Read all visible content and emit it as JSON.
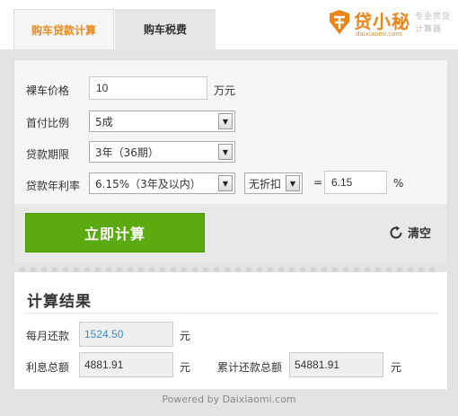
{
  "tabs": [
    {
      "label": "购车贷款计算",
      "active": true
    },
    {
      "label": "购车税费",
      "active": false
    }
  ],
  "logo": {
    "brand": "贷小秘",
    "domain": "daixiaomi.com",
    "slogan": "专业房贷计算器"
  },
  "form": {
    "price": {
      "label": "裸车价格",
      "value": "10",
      "unit": "万元"
    },
    "down_payment": {
      "label": "首付比例",
      "selected": "5成"
    },
    "term": {
      "label": "贷款期限",
      "selected": "3年（36期）"
    },
    "rate": {
      "label": "贷款年利率",
      "selected": "6.15%（3年及以内）",
      "discount": "无折扣",
      "equals": "=",
      "value": "6.15",
      "unit": "%"
    }
  },
  "actions": {
    "calculate": "立即计算",
    "clear": "清空"
  },
  "result": {
    "title": "计算结果",
    "monthly": {
      "label": "每月还款",
      "value": "1524.50",
      "unit": "元"
    },
    "interest": {
      "label": "利息总额",
      "value": "4881.91",
      "unit": "元"
    },
    "total": {
      "label": "累计还款总额",
      "value": "54881.91",
      "unit": "元"
    }
  },
  "footer": "Powered by Daixiaomi.com",
  "colors": {
    "accent": "#ea8a1c",
    "button": "#5aaa10",
    "monthly_value": "#3a8cc8"
  }
}
